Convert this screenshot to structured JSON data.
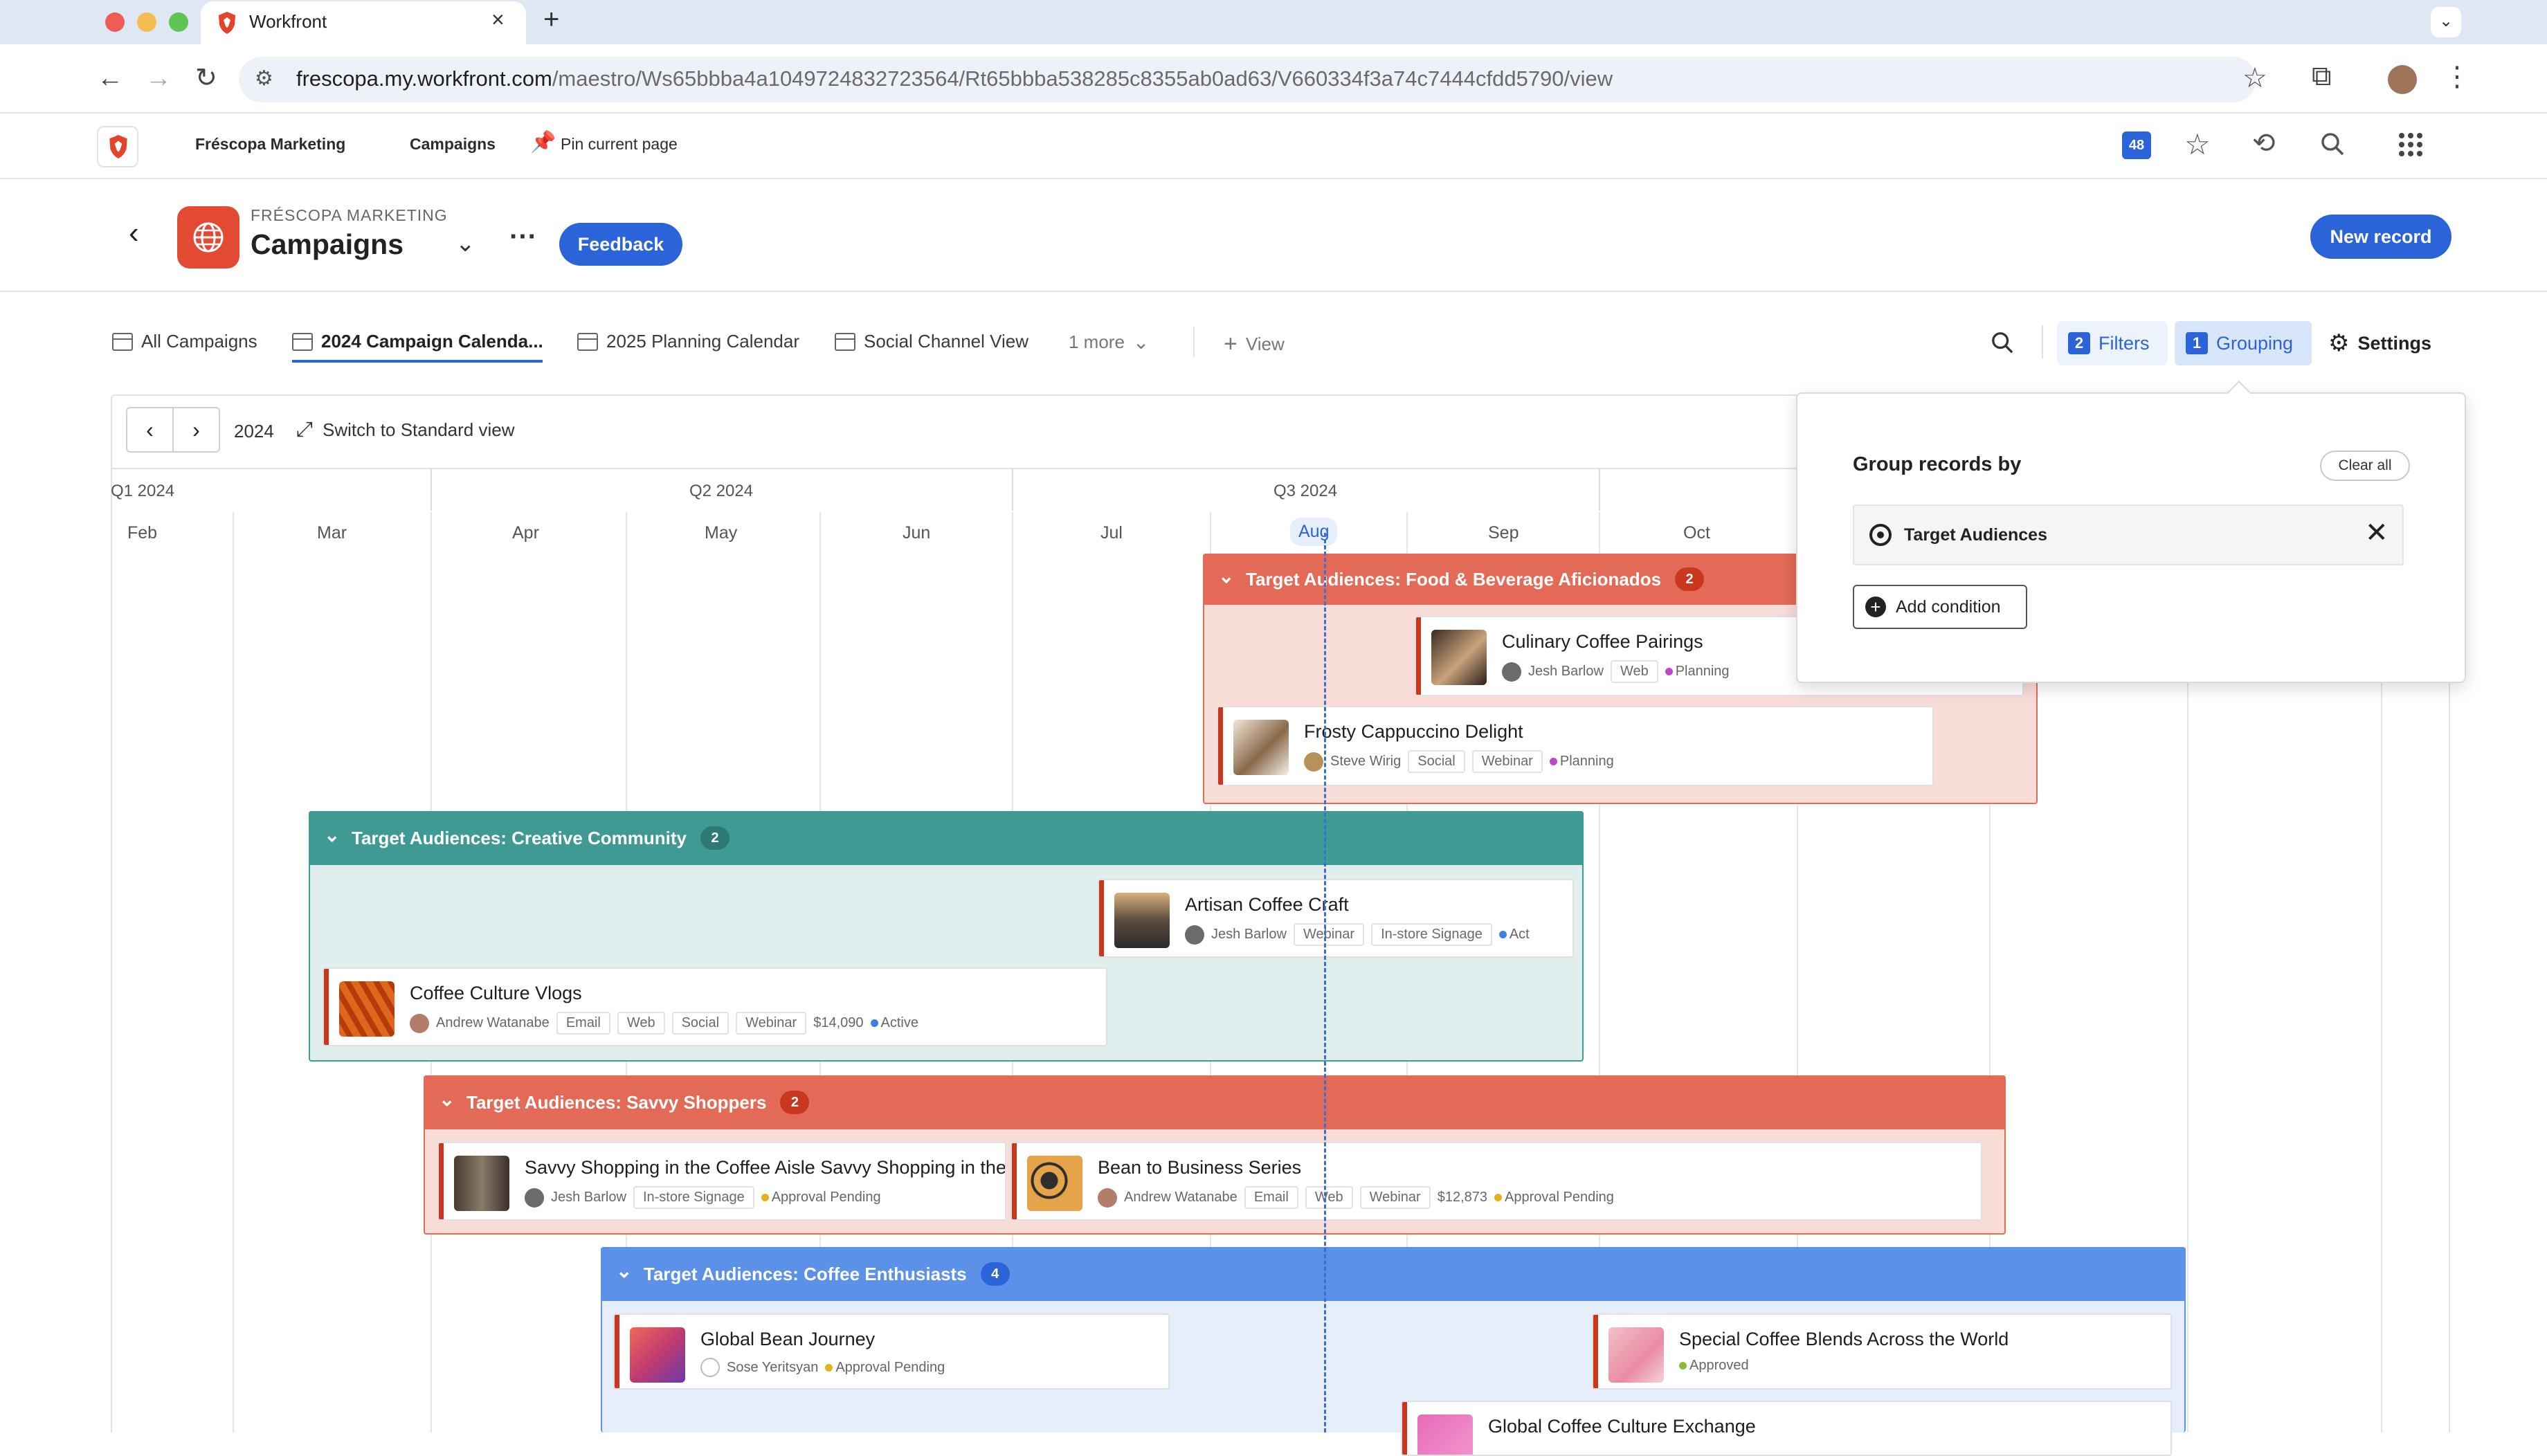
{
  "browser": {
    "tab_title": "Workfront",
    "url_host": "frescopa.my.workfront.com",
    "url_path": "/maestro/Ws65bbba4a1049724832723564/Rt65bbba538285c8355ab0ad63/V660334f3a74c7444cfdd5790/view"
  },
  "appnav": {
    "brand": "Fréscopa Marketing",
    "campaigns": "Campaigns",
    "pin": "Pin current page",
    "badge_count": "48"
  },
  "header": {
    "eyebrow": "FRÉSCOPA MARKETING",
    "title": "Campaigns",
    "feedback": "Feedback",
    "new_record": "New record"
  },
  "views": {
    "tabs": [
      "All Campaigns",
      "2024 Campaign Calenda...",
      "2025 Planning Calendar",
      "Social Channel View"
    ],
    "more": "1 more",
    "add_view": "View",
    "filters_count": "2",
    "filters": "Filters",
    "grouping_count": "1",
    "grouping": "Grouping",
    "settings": "Settings"
  },
  "timeline": {
    "year": "2024",
    "switch": "Switch to Standard view",
    "quarters": [
      "Q1 2024",
      "Q2 2024",
      "Q3 2024"
    ],
    "months": [
      "Feb",
      "Mar",
      "Apr",
      "May",
      "Jun",
      "Jul",
      "Aug",
      "Sep",
      "Oct"
    ]
  },
  "groups": [
    {
      "label": "Target Audiences: Food & Beverage Aficionados",
      "count": "2",
      "records": [
        {
          "title": "Culinary Coffee Pairings",
          "owner": "Jesh Barlow",
          "chips": [
            "Web"
          ],
          "budget": "",
          "status": "Planning",
          "status_color": "#c048c8"
        },
        {
          "title": "Frosty Cappuccino Delight",
          "owner": "Steve Wirig",
          "chips": [
            "Social",
            "Webinar"
          ],
          "budget": "",
          "status": "Planning",
          "status_color": "#c048c8"
        }
      ]
    },
    {
      "label": "Target Audiences: Creative Community",
      "count": "2",
      "records": [
        {
          "title": "Artisan Coffee Craft",
          "owner": "Jesh Barlow",
          "chips": [
            "Webinar",
            "In-store Signage"
          ],
          "budget": "",
          "status": "Act",
          "status_color": "#3b82e0"
        },
        {
          "title": "Coffee Culture Vlogs",
          "owner": "Andrew Watanabe",
          "chips": [
            "Email",
            "Web",
            "Social",
            "Webinar"
          ],
          "budget": "$14,090",
          "status": "Active",
          "status_color": "#3b82e0"
        }
      ]
    },
    {
      "label": "Target Audiences: Savvy Shoppers",
      "count": "2",
      "records": [
        {
          "title": "Savvy Shopping in the Coffee Aisle Savvy Shopping in the Cof",
          "owner": "Jesh Barlow",
          "chips": [
            "In-store Signage"
          ],
          "budget": "",
          "status": "Approval Pending",
          "status_color": "#e3b21c"
        },
        {
          "title": "Bean to Business Series",
          "owner": "Andrew Watanabe",
          "chips": [
            "Email",
            "Web",
            "Webinar"
          ],
          "budget": "$12,873",
          "status": "Approval Pending",
          "status_color": "#e3b21c"
        }
      ]
    },
    {
      "label": "Target Audiences: Coffee Enthusiasts",
      "count": "4",
      "records": [
        {
          "title": "Global Bean Journey",
          "owner": "Sose Yeritsyan",
          "chips": [],
          "budget": "",
          "status": "Approval Pending",
          "status_color": "#e3b21c"
        },
        {
          "title": "Special Coffee Blends Across the World",
          "owner": "",
          "chips": [],
          "budget": "",
          "status": "Approved",
          "status_color": "#8cbc35"
        },
        {
          "title": "Global Coffee Culture Exchange",
          "owner": "",
          "chips": [],
          "budget": "",
          "status": "",
          "status_color": ""
        }
      ]
    }
  ],
  "grouping_panel": {
    "title": "Group records by",
    "clear": "Clear all",
    "field": "Target Audiences",
    "add": "Add condition"
  }
}
